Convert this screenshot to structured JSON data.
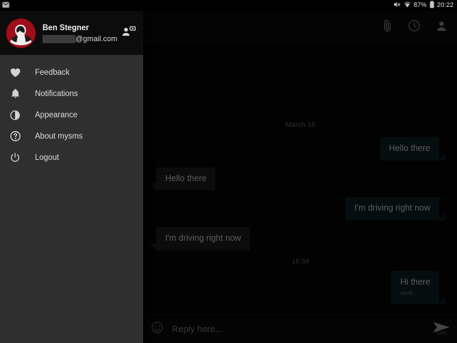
{
  "status_bar": {
    "notification_icon": "message-notification-icon",
    "mute_icon": "volume-mute-icon",
    "wifi_icon": "wifi-icon",
    "battery_percent": "87%",
    "battery_icon": "battery-icon",
    "clock": "20:22"
  },
  "app_bar": {
    "attach_icon": "paperclip-icon",
    "history_icon": "clock-icon",
    "contact_icon": "person-icon"
  },
  "drawer": {
    "account": {
      "name": "Ben Stegner",
      "email_redacted": "",
      "email_domain": "@gmail.com",
      "avatar_icon": "user-avatar",
      "switch_account_icon": "manage-accounts-icon"
    },
    "items": [
      {
        "label": "Feedback",
        "icon": "heart-icon"
      },
      {
        "label": "Notifications",
        "icon": "bell-icon"
      },
      {
        "label": "Appearance",
        "icon": "contrast-icon"
      },
      {
        "label": "About mysms",
        "icon": "help-circle-icon"
      },
      {
        "label": "Logout",
        "icon": "power-icon"
      }
    ]
  },
  "conversation": {
    "date_separator": "March 16",
    "time_separator": "16:56",
    "messages": [
      {
        "text": "Hello there",
        "direction": "out",
        "status": ""
      },
      {
        "text": "Hello there",
        "direction": "in",
        "status": ""
      },
      {
        "text": "I'm driving right now",
        "direction": "out",
        "status": ""
      },
      {
        "text": "I'm driving right now",
        "direction": "in",
        "status": ""
      },
      {
        "text": "Hi there",
        "direction": "out",
        "status": "sent"
      }
    ]
  },
  "composer": {
    "emoji_icon": "emoji-smiley-icon",
    "placeholder": "Reply here...",
    "value": "",
    "send_icon": "send-arrow-icon",
    "send_label": "SMS"
  },
  "colors": {
    "outgoing_bubble": "#0d1f22",
    "incoming_bubble": "#1c1c1c",
    "drawer_bg": "#2f2f2f",
    "avatar_bg": "#9e0d18",
    "fab": "#a81a52"
  }
}
